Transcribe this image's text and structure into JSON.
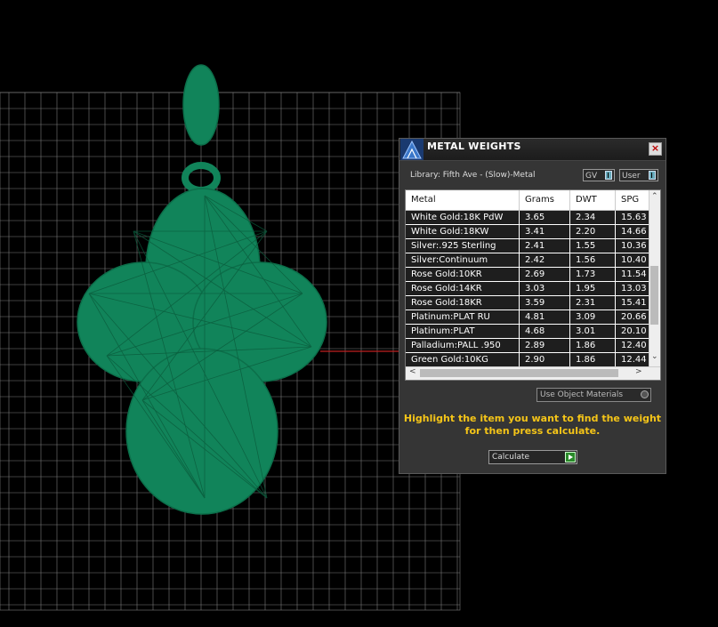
{
  "panel": {
    "title": "METAL WEIGHTS",
    "library_label": "Library: Fifth Ave - (Slow)-Metal",
    "toggle_gv": "GV",
    "toggle_user": "User",
    "columns": [
      "Metal",
      "Grams",
      "DWT",
      "SPG"
    ],
    "rows": [
      [
        "White Gold:18K PdW",
        "3.65",
        "2.34",
        "15.63"
      ],
      [
        "White Gold:18KW",
        "3.41",
        "2.20",
        "14.66"
      ],
      [
        "Silver:.925 Sterling",
        "2.41",
        "1.55",
        "10.36"
      ],
      [
        "Silver:Continuum",
        "2.42",
        "1.56",
        "10.40"
      ],
      [
        "Rose Gold:10KR",
        "2.69",
        "1.73",
        "11.54"
      ],
      [
        "Rose Gold:14KR",
        "3.03",
        "1.95",
        "13.03"
      ],
      [
        "Rose Gold:18KR",
        "3.59",
        "2.31",
        "15.41"
      ],
      [
        "Platinum:PLAT RU",
        "4.81",
        "3.09",
        "20.66"
      ],
      [
        "Platinum:PLAT",
        "4.68",
        "3.01",
        "20.10"
      ],
      [
        "Palladium:PALL .950",
        "2.89",
        "1.86",
        "12.40"
      ],
      [
        "Green Gold:10KG",
        "2.90",
        "1.86",
        "12.44"
      ]
    ],
    "use_object_materials": "Use Object Materials",
    "hint_line1": "Highlight the item you want to find the weight",
    "hint_line2": "for then press calculate.",
    "calculate_label": "Calculate"
  },
  "colors": {
    "model": "#11845a",
    "grid": "#8a8a8a",
    "hint": "#f5c518"
  }
}
